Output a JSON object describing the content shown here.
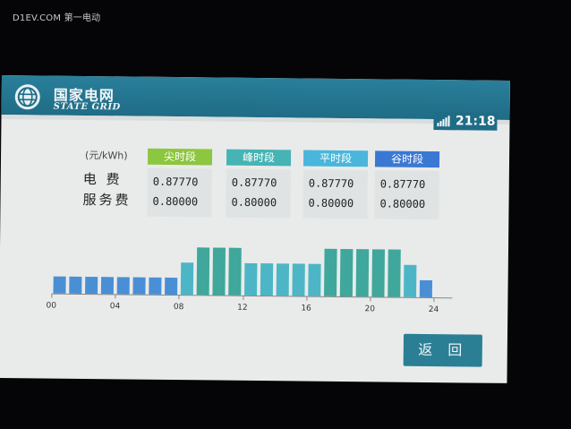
{
  "watermark": "D1EV.COM 第一电动",
  "header": {
    "logo_cn": "国家电网",
    "logo_en": "STATE GRID",
    "time": "21:18"
  },
  "table": {
    "unit": "(元/kWh)",
    "rows": [
      "电  费",
      "服务费"
    ],
    "columns": [
      {
        "label": "尖时段",
        "color": "#8dc63f",
        "electricity": "0.87770",
        "service": "0.80000"
      },
      {
        "label": "峰时段",
        "color": "#46b4b4",
        "electricity": "0.87770",
        "service": "0.80000"
      },
      {
        "label": "平时段",
        "color": "#4ab6dc",
        "electricity": "0.87770",
        "service": "0.80000"
      },
      {
        "label": "谷时段",
        "color": "#3a78d4",
        "electricity": "0.87770",
        "service": "0.80000"
      }
    ]
  },
  "chart_data": {
    "type": "bar",
    "x_ticks": [
      "00",
      "04",
      "08",
      "12",
      "16",
      "20",
      "24"
    ],
    "categories": [
      "0",
      "1",
      "2",
      "3",
      "4",
      "5",
      "6",
      "7",
      "8",
      "9",
      "10",
      "11",
      "12",
      "13",
      "14",
      "15",
      "16",
      "17",
      "18",
      "19",
      "20",
      "21",
      "22",
      "23"
    ],
    "periods": [
      "谷",
      "谷",
      "谷",
      "谷",
      "谷",
      "谷",
      "谷",
      "谷",
      "平",
      "峰",
      "峰",
      "峰",
      "平",
      "平",
      "平",
      "平",
      "平",
      "峰",
      "峰",
      "峰",
      "峰",
      "峰",
      "平",
      "谷"
    ],
    "values": [
      1,
      1,
      1,
      1,
      1,
      1,
      1,
      1,
      2,
      3,
      3,
      3,
      2,
      2,
      2,
      2,
      2,
      3,
      3,
      3,
      3,
      3,
      2,
      1
    ],
    "colors": {
      "峰": "#3fa79b",
      "平": "#4db6c6",
      "谷": "#4a8fd6"
    }
  },
  "back_button": "返 回"
}
